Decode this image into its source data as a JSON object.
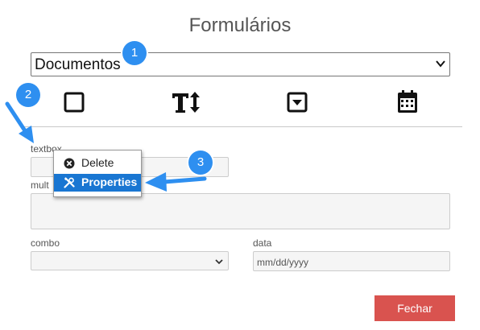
{
  "dialog": {
    "title": "Formulários"
  },
  "document_select": {
    "value": "Documentos"
  },
  "toolbar": {
    "icons": [
      "checkbox-icon",
      "text-size-icon",
      "dropdown-icon",
      "calendar-icon"
    ]
  },
  "fields": {
    "textbox_label": "textbox",
    "multiline_label": "mult",
    "combo_label": "combo",
    "date_label": "data",
    "date_placeholder": "mm/dd/yyyy"
  },
  "context_menu": {
    "delete_label": "Delete",
    "properties_label": "Properties"
  },
  "callouts": [
    "1",
    "2",
    "3"
  ],
  "footer": {
    "close_label": "Fechar"
  },
  "colors": {
    "accent": "#1976d2",
    "badge": "#2e8ff0",
    "close_button": "#d9534f"
  }
}
